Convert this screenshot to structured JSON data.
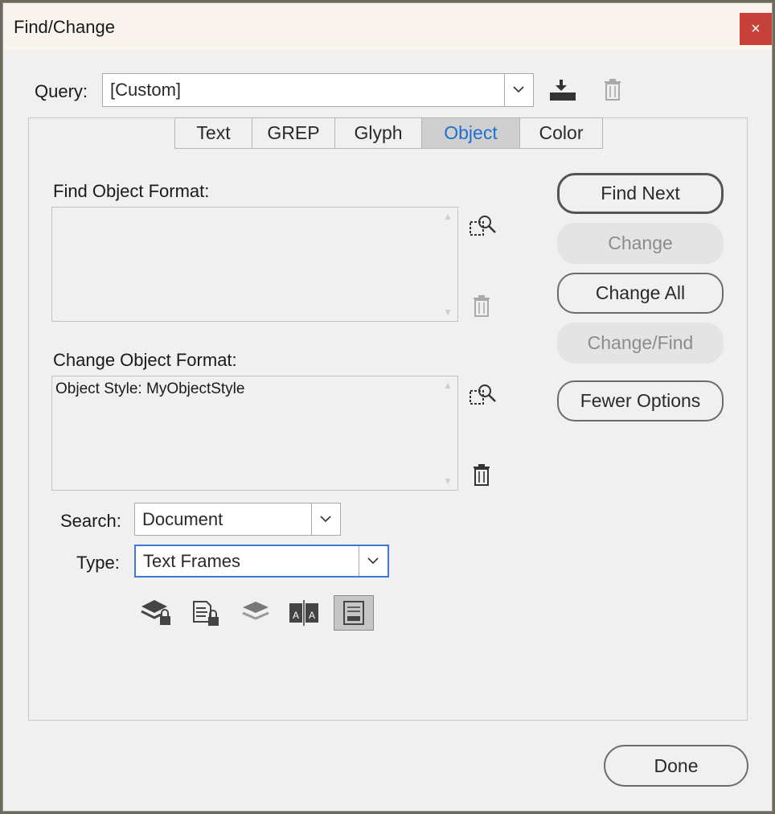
{
  "window": {
    "title": "Find/Change",
    "close_glyph": "×"
  },
  "query": {
    "label": "Query:",
    "value": "[Custom]"
  },
  "tabs": [
    {
      "label": "Text"
    },
    {
      "label": "GREP"
    },
    {
      "label": "Glyph"
    },
    {
      "label": "Object",
      "active": true
    },
    {
      "label": "Color"
    }
  ],
  "find_format": {
    "label": "Find Object Format:",
    "value": ""
  },
  "change_format": {
    "label": "Change Object Format:",
    "value": "Object Style: MyObjectStyle"
  },
  "search": {
    "label": "Search:",
    "value": "Document"
  },
  "type": {
    "label": "Type:",
    "value": "Text Frames"
  },
  "buttons": {
    "find_next": "Find Next",
    "change": "Change",
    "change_all": "Change All",
    "change_find": "Change/Find",
    "fewer_options": "Fewer Options",
    "done": "Done"
  },
  "icons": {
    "save_query": "save-query-icon",
    "delete_query": "trash-icon",
    "specify_find": "specify-attributes-icon",
    "clear_find": "trash-icon",
    "specify_change": "specify-attributes-icon",
    "clear_change": "trash-icon",
    "options": [
      "locked-layers-icon",
      "locked-items-icon",
      "hidden-layers-icon",
      "master-pages-icon",
      "footnotes-icon"
    ]
  },
  "colors": {
    "accent": "#1f6fd1",
    "close": "#c7413b",
    "focus": "#3d7ad6"
  }
}
